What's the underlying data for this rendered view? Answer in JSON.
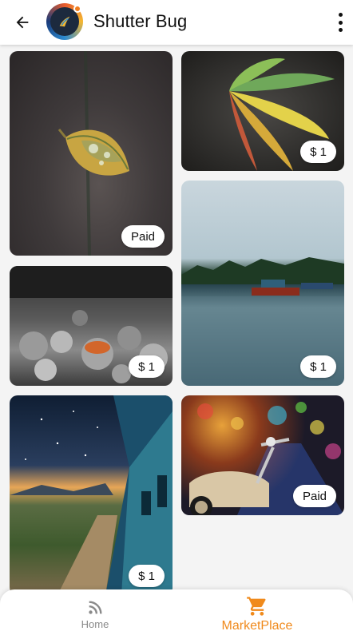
{
  "appbar": {
    "title": "Shutter Bug"
  },
  "photos": [
    {
      "price": "Paid"
    },
    {
      "price": "$ 1"
    },
    {
      "price": "$ 1"
    },
    {
      "price": "$ 1"
    },
    {
      "price": "$ 1"
    },
    {
      "price": "Paid"
    }
  ],
  "bottom_nav": {
    "home_label": "Home",
    "marketplace_label": "MarketPlace",
    "active": "MarketPlace"
  },
  "colors": {
    "accent": "#f08a1c",
    "inactive": "#8a8a8a"
  }
}
